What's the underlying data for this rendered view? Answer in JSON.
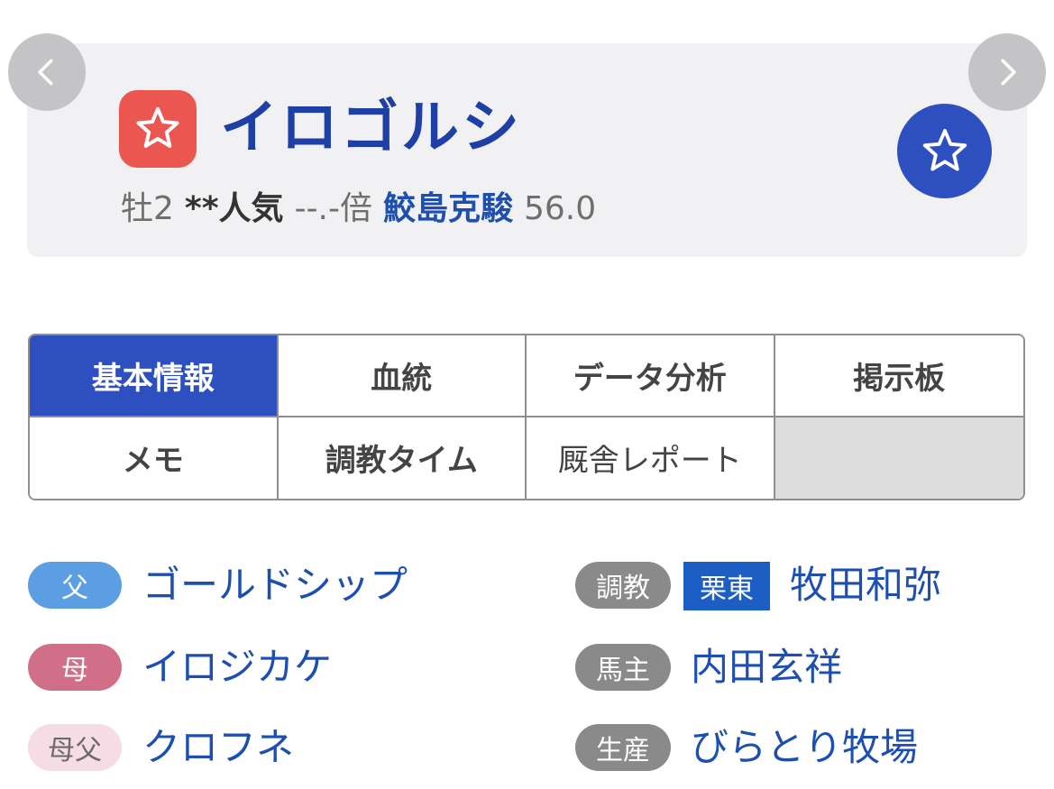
{
  "header": {
    "horse_name": "イロゴルシ",
    "sex_age": "牡2",
    "popularity": "**人気",
    "odds": "--.-倍",
    "jockey": "鮫島克駿",
    "weight": "56.0",
    "horse_icon": "star-outline-icon",
    "favorite_icon": "star-outline-icon",
    "prev_icon": "chevron-left-icon",
    "next_icon": "chevron-right-icon"
  },
  "tabs": [
    {
      "label": "基本情報",
      "active": true
    },
    {
      "label": "血統",
      "active": false
    },
    {
      "label": "データ分析",
      "active": false
    },
    {
      "label": "掲示板",
      "active": false
    },
    {
      "label": "メモ",
      "active": false
    },
    {
      "label": "調教タイム",
      "active": false
    },
    {
      "label": "厩舎レポート",
      "active": false
    }
  ],
  "details": {
    "sire": {
      "label": "父",
      "value": "ゴールドシップ"
    },
    "dam": {
      "label": "母",
      "value": "イロジカケ"
    },
    "damsire": {
      "label": "母父",
      "value": "クロフネ"
    },
    "trainer": {
      "label": "調教",
      "region": "栗東",
      "value": "牧田和弥"
    },
    "owner": {
      "label": "馬主",
      "value": "内田玄祥"
    },
    "breeder": {
      "label": "生産",
      "value": "びらとり牧場"
    }
  },
  "colors": {
    "primary_blue": "#2e4fbf",
    "name_blue": "#1d3fa6",
    "link_blue": "#1d4fb0",
    "icon_red": "#ec5651",
    "sire_blue": "#5b9fe2",
    "dam_pink": "#d06f87",
    "damsire_pink": "#f6dce4",
    "label_gray": "#8a8a8a"
  }
}
